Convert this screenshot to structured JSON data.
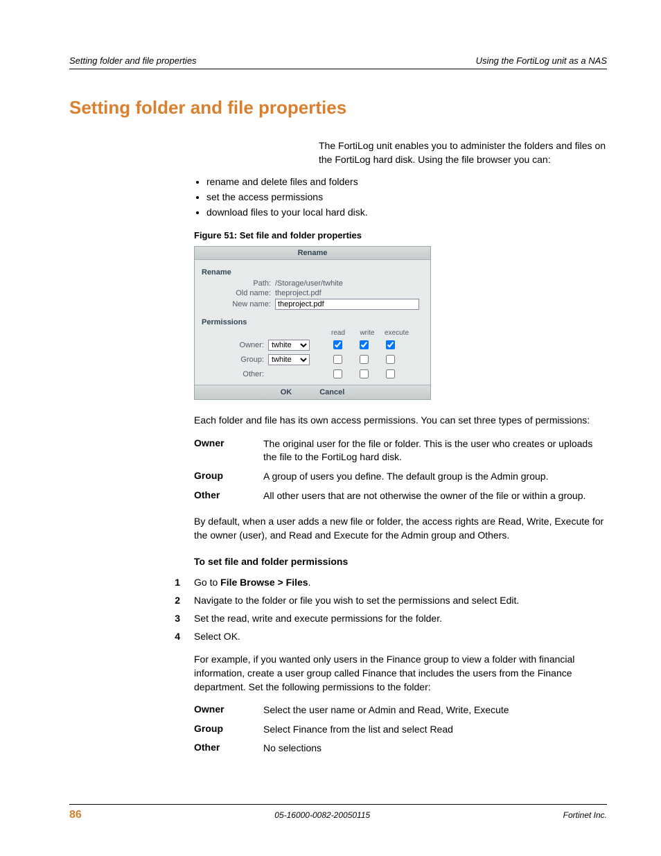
{
  "header": {
    "left": "Setting folder and file properties",
    "right": "Using the FortiLog unit as a NAS"
  },
  "title": "Setting folder and file properties",
  "intro": "The FortiLog unit enables you to administer the folders and files on the FortiLog hard disk. Using the file browser you can:",
  "bullets": [
    "rename and delete files and folders",
    "set the access permissions",
    "download files to your local hard disk."
  ],
  "figure_caption": "Figure 51: Set file and folder properties",
  "dialog": {
    "title": "Rename",
    "rename_section": "Rename",
    "path_label": "Path:",
    "path_value": "/Storage/user/twhite",
    "oldname_label": "Old name:",
    "oldname_value": "theproject.pdf",
    "newname_label": "New name:",
    "newname_value": "theproject.pdf",
    "perm_section": "Permissions",
    "col_read": "read",
    "col_write": "write",
    "col_exec": "execute",
    "owner_label": "Owner:",
    "owner_value": "twhite",
    "group_label": "Group:",
    "group_value": "twhite",
    "other_label": "Other:",
    "ok": "OK",
    "cancel": "Cancel"
  },
  "after_figure": "Each folder and file has its own access permissions. You can set three types of permissions:",
  "defs1": [
    {
      "term": "Owner",
      "desc": "The original user for the file or folder. This is the user who creates or uploads the file to the FortiLog hard disk."
    },
    {
      "term": "Group",
      "desc": "A group of users you define. The default group is the Admin group."
    },
    {
      "term": "Other",
      "desc": "All other users that are not otherwise the owner of the file or within a group."
    }
  ],
  "after_defs1": "By default, when a user adds a new file or folder, the access rights are Read, Write, Execute for the owner (user), and Read and Execute for the Admin group and Others.",
  "subhead": "To set file and folder permissions",
  "steps": [
    {
      "n": "1",
      "pre": "Go to ",
      "bold": "File Browse > Files",
      "post": "."
    },
    {
      "n": "2",
      "pre": "Navigate to the folder or file you wish to set the permissions and select Edit.",
      "bold": "",
      "post": ""
    },
    {
      "n": "3",
      "pre": "Set the read, write and execute permissions for the folder.",
      "bold": "",
      "post": ""
    },
    {
      "n": "4",
      "pre": "Select OK.",
      "bold": "",
      "post": ""
    }
  ],
  "example_para": "For example, if you wanted only users in the Finance group to view a folder with financial information, create a user group called Finance that includes the users from the Finance department. Set the following permissions to the folder:",
  "defs2": [
    {
      "term": "Owner",
      "desc": "Select the user name or Admin and Read, Write, Execute"
    },
    {
      "term": "Group",
      "desc": "Select Finance from the list and select Read"
    },
    {
      "term": "Other",
      "desc": "No selections"
    }
  ],
  "footer": {
    "page": "86",
    "mid": "05-16000-0082-20050115",
    "right": "Fortinet Inc."
  }
}
